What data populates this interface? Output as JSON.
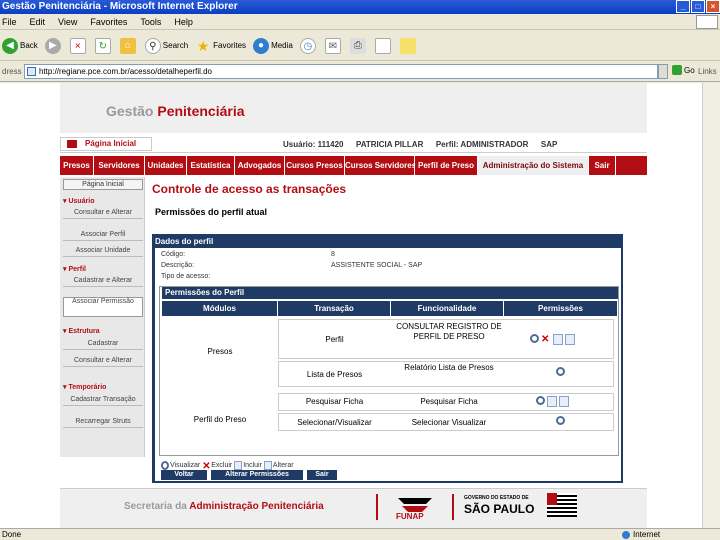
{
  "window": {
    "title": "Gestão Penitenciária - Microsoft Internet Explorer"
  },
  "menu": [
    "File",
    "Edit",
    "View",
    "Favorites",
    "Tools",
    "Help"
  ],
  "toolbar": {
    "back": "Back",
    "search": "Search",
    "favorites": "Favorites",
    "media": "Media"
  },
  "address": {
    "label": "dress",
    "url": "http://regiane.pce.com.br/acesso/detalheperfil.do",
    "go": "Go",
    "links": "Links"
  },
  "header": {
    "title_gray": "Gestão",
    "title_red": "Penitenciária"
  },
  "userbar": {
    "home": "Página Inicial",
    "user": "Usuário: 111420",
    "name": "PATRICIA PILLAR",
    "perfil": "Perfil: ADMINISTRADOR",
    "system": "SAP"
  },
  "nav": [
    {
      "label": "Presos",
      "width": 34
    },
    {
      "label": "Servidores",
      "width": 51
    },
    {
      "label": "Unidades",
      "width": 42
    },
    {
      "label": "Estatística",
      "width": 48
    },
    {
      "label": "Advogados",
      "width": 50
    },
    {
      "label": "Cursos Presos",
      "width": 60
    },
    {
      "label": "Cursos Servidores",
      "width": 70
    },
    {
      "label": "Perfil de Preso",
      "width": 63
    },
    {
      "label": "Administração do Sistema",
      "width": 111,
      "active": true
    },
    {
      "label": "Sair",
      "width": 27
    }
  ],
  "sidebar": {
    "home": "Página Inicial",
    "sec_usuario": "Usuário",
    "consultar_alterar": "Consultar e Alterar",
    "associar_perfil": "Associar Perfil",
    "associar_unidade": "Associar Unidade",
    "sec_perfil": "Perfil",
    "cadastrar_alterar": "Cadastrar e Alterar",
    "associar_permissao": "Associar Permissão",
    "sec_estrutura": "Estrutura",
    "cadastrar": "Cadastrar",
    "consultar_alterar2": "Consultar e Alterar",
    "sec_temporario": "Temporário",
    "cadastrar_transacao": "Cadastrar Transação",
    "recarregar": "Recarregar Struts"
  },
  "content": {
    "title": "Controle de acesso as transações",
    "subtitle": "Permissões do perfil atual",
    "panel_title": "Dados do perfil",
    "codigo_label": "Código:",
    "codigo_value": "8",
    "descricao_label": "Descrição:",
    "descricao_value": "ASSISTENTE SOCIAL - SAP",
    "tipo_label": "Tipo de acesso:",
    "perm_title": "Permissões do Perfil",
    "headers": [
      "Módulos",
      "Transação",
      "Funcionalidade",
      "Permissões"
    ],
    "mod_presos": "Presos",
    "mod_perfil": "Perfil do Preso",
    "r1_trans": "Perfil",
    "r1_func": "CONSULTAR REGISTRO DE PERFIL DE PRESO",
    "r2_trans": "Lista de Presos",
    "r2_func": "Relatório Lista de Presos",
    "r3_trans": "Pesquisar Ficha",
    "r3_func": "Pesquisar Ficha",
    "r4_trans": "Selecionar/Visualizar",
    "r4_func": "Selecionar Visualizar",
    "legend": {
      "visualizar": "Visualizar",
      "excluir": "Excluir",
      "incluir": "Incluir",
      "alterar": "Alterar"
    },
    "btn_voltar": "Voltar",
    "btn_alterar": "Alterar Permissões",
    "btn_sair": "Sair"
  },
  "footer": {
    "text_gray": "Secretaria da",
    "text_red": "Administração Penitenciária",
    "funap": "FUNAP",
    "gov_small": "GOVERNO DO ESTADO DE",
    "gov_big": "SÃO PAULO"
  },
  "status": {
    "left": "Done",
    "right": "Internet"
  }
}
